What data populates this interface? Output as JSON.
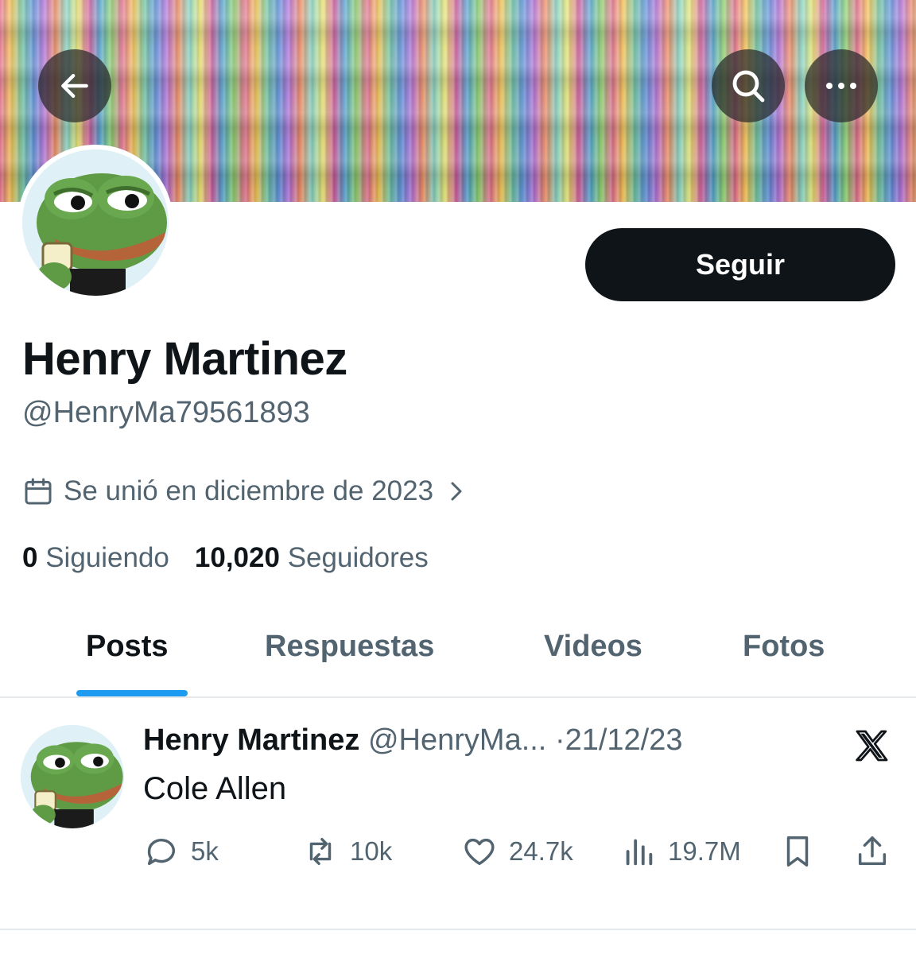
{
  "header": {
    "back_icon": "arrow-left-icon",
    "search_icon": "search-icon",
    "more_icon": "more-horizontal-icon"
  },
  "profile": {
    "name": "Henry Martinez",
    "handle": "@HenryMa79561893",
    "follow_label": "Seguir",
    "joined_text": "Se unió en diciembre de 2023",
    "following_count": "0",
    "following_label": "Siguiendo",
    "followers_count": "10,020",
    "followers_label": "Seguidores"
  },
  "tabs": [
    {
      "label": "Posts",
      "active": true
    },
    {
      "label": "Respuestas",
      "active": false
    },
    {
      "label": "Videos",
      "active": false
    },
    {
      "label": "Fotos",
      "active": false
    }
  ],
  "post": {
    "author_name": "Henry Martinez",
    "author_handle": "@HenryMa...",
    "separator": "·",
    "date": "21/12/23",
    "text": "Cole Allen",
    "replies": "5k",
    "reposts": "10k",
    "likes": "24.7k",
    "views": "19.7M"
  },
  "colors": {
    "accent": "#1d9bf0",
    "text_primary": "#0f1419",
    "text_secondary": "#536471",
    "button_dark": "#0f1419"
  }
}
